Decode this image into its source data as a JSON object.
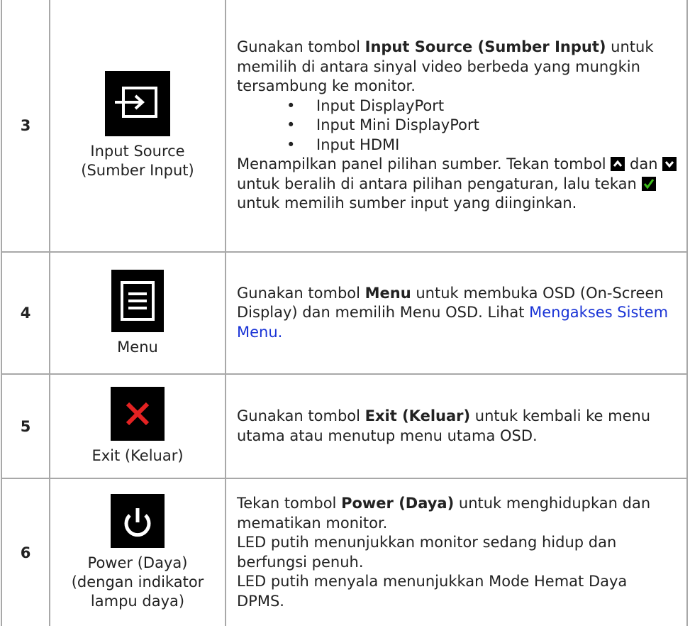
{
  "rows": [
    {
      "number": "3",
      "icon": "input-source-icon",
      "label_lines": [
        "Input Source",
        "(Sumber Input)"
      ],
      "intro_pre": "Gunakan tombol ",
      "intro_bold": "Input Source (Sumber Input)",
      "intro_post": " untuk memilih di antara sinyal video berbeda yang mungkin tersambung ke monitor.",
      "bullets": [
        "Input DisplayPort",
        "Input Mini DisplayPort",
        "Input HDMI"
      ],
      "after_1": "Menampilkan panel pilihan sumber. Tekan tombol ",
      "after_2": " dan ",
      "after_3": " untuk beralih di antara pilihan pengaturan, lalu tekan ",
      "after_4": " untuk memilih sumber input yang diinginkan."
    },
    {
      "number": "4",
      "icon": "menu-icon",
      "label_lines": [
        "Menu"
      ],
      "pre": "Gunakan tombol ",
      "bold": "Menu",
      "post": " untuk membuka OSD (On-Screen Display) dan memilih Menu OSD. Lihat ",
      "link": "Mengakses Sistem Menu."
    },
    {
      "number": "5",
      "icon": "exit-x-icon",
      "label_lines": [
        "Exit (Keluar)"
      ],
      "pre": "Gunakan tombol ",
      "bold": "Exit (Keluar)",
      "post": " untuk kembali ke menu utama atau menutup menu utama OSD."
    },
    {
      "number": "6",
      "icon": "power-icon",
      "label_lines": [
        "Power (Daya)",
        "(dengan indikator",
        "lampu daya)"
      ],
      "pre": "Tekan tombol ",
      "bold": "Power (Daya)",
      "post": " untuk menghidupkan dan mematikan monitor.",
      "line_2": "LED putih menunjukkan monitor sedang hidup dan berfungsi penuh.",
      "line_3": "LED putih menyala menunjukkan Mode Hemat Daya DPMS."
    }
  ],
  "colors": {
    "icon_bg": "#000000",
    "exit_red": "#e32222",
    "check_green": "#3dbd1a",
    "link_blue": "#1a34d6",
    "border": "#a8a8a8"
  }
}
